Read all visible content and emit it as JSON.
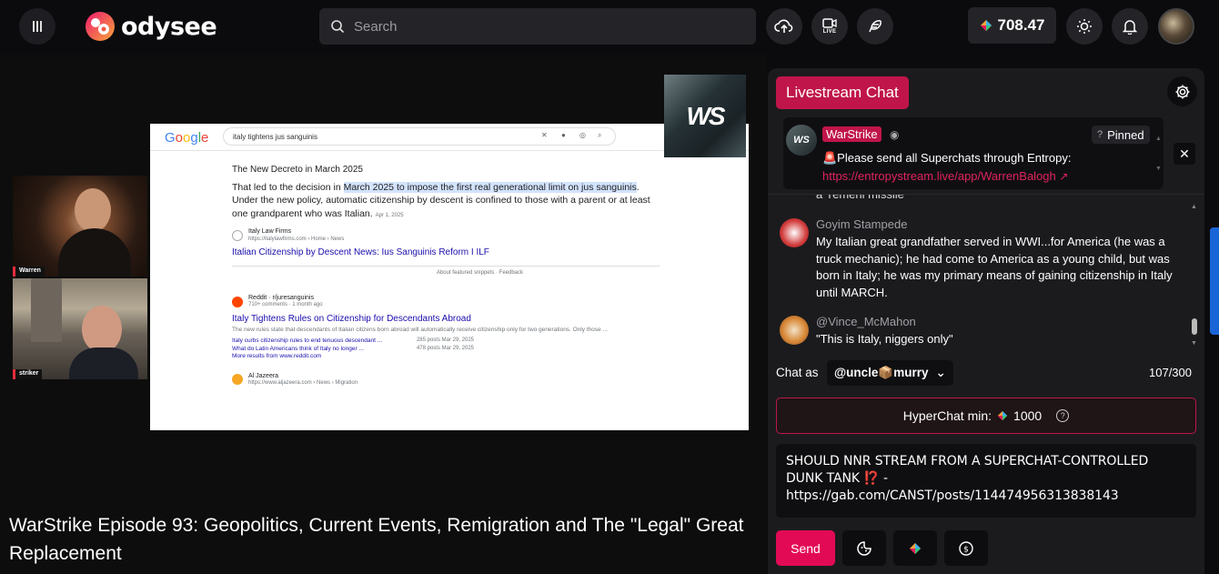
{
  "header": {
    "logo_text": "odysee",
    "search_placeholder": "Search",
    "live_label": "LIVE",
    "credits": "708.47"
  },
  "screen_share": {
    "google_logo": "Google",
    "query": "italy tightens jus sanguinis",
    "heading": "The New Decreto in March 2025",
    "snippet_pre": "That led to the decision in ",
    "snippet_hl": "March 2025 to impose the first real generational limit on jus sanguinis",
    "snippet_post": ". Under the new policy, automatic citizenship by descent is confined to those with a parent or at least one grandparent who was Italian.",
    "snippet_date": "Apr 1, 2025",
    "src1_name": "Italy Law Firms",
    "src1_url": "https://italylawfirms.com › Home › News",
    "src1_title": "Italian Citizenship by Descent News: Ius Sanguinis Reform I ILF",
    "feedback": "About featured snippets  ·  Feedback",
    "src2_name": "Reddit · r/juresanguinis",
    "src2_meta": "710+ comments · 1 month ago",
    "src2_title": "Italy Tightens Rules on Citizenship for Descendants Abroad",
    "src2_desc": "The new rules state that descendants of Italian citizens born abroad will automatically receive citizenship only for two generations. Only those ...",
    "sub1": "Italy curbs citizenship rules to end tenuous descendant ...",
    "sub1_meta": "285 posts    Mar 29, 2025",
    "sub2": "What do Latin Americans think of Italy no longer ...",
    "sub2_meta": "478 posts    Mar 29, 2025",
    "more": "More results from www.reddit.com",
    "src3_name": "Al Jazeera",
    "src3_url": "https://www.aljazeera.com › News › Migration",
    "badge": "WS"
  },
  "cams": [
    {
      "label": "Warren"
    },
    {
      "label": "striker"
    }
  ],
  "video_title": "WarStrike Episode 93: Geopolitics, Current Events, Remigration and The \"Legal\" Great Replacement",
  "chat": {
    "tab_label": "Livestream Chat",
    "pinned": {
      "avatar_text": "WS",
      "name": "WarStrike",
      "label": "Pinned",
      "text": "🚨Please send all Superchats through Entropy:",
      "link": "https://entropystream.live/app/WarrenBalogh"
    },
    "cut_text": "a Yemeni missile",
    "messages": [
      {
        "name": "Goyim Stampede",
        "body": "My Italian great grandfather served in WWI...for America (he was a truck mechanic); he had come to America as a young child, but was born in Italy; he was my primary means of gaining citizenship in Italy until MARCH."
      },
      {
        "name": "@Vince_McMahon",
        "body": "\"This is Italy, niggers only\""
      }
    ],
    "chat_as_label": "Chat as",
    "user": "@uncle📦murry",
    "char_count": "107/300",
    "hyperchat_label": "HyperChat min:",
    "hyperchat_value": "1000",
    "composer_text": "SHOULD NNR STREAM FROM A SUPERCHAT-CONTROLLED DUNK TANK ⁉️ - https://gab.com/CANST/posts/114474956313838143",
    "send_label": "Send"
  },
  "colors": {
    "accent": "#e20a55",
    "brand_tab": "#c0154a",
    "background": "#0b0b0d"
  }
}
